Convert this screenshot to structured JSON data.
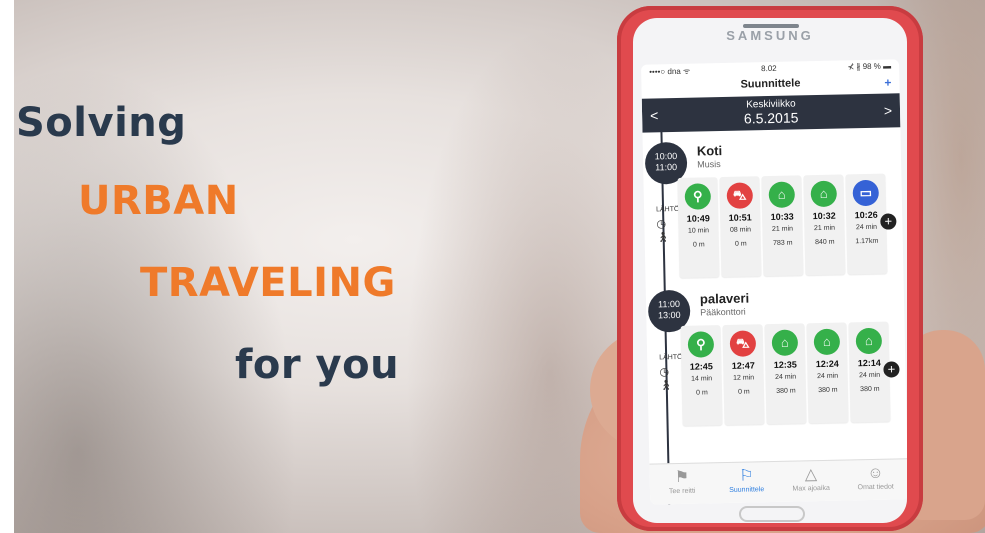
{
  "hero": {
    "line1": "Solving",
    "line2": "URBAN",
    "line3": "TRAVELING",
    "line4": "for you",
    "colors": {
      "dark": "#2a3a4d",
      "accent": "#ef7a2a"
    }
  },
  "carousel": {
    "active_index": 0,
    "count": 2
  },
  "phone": {
    "brand": "SAMSUNG",
    "status": {
      "carrier": "••••○ dna ᯤ",
      "time": "8.02",
      "battery": "⊀ ∦ 98 % ▬"
    },
    "nav_title": "Suunnittele",
    "nav_action": "+",
    "date": {
      "weekday": "Keskiviikko",
      "date": "6.5.2015",
      "prev": "<",
      "next": ">"
    },
    "labels": {
      "depart": "LÄHTÖ"
    },
    "events": [
      {
        "start": "10:00",
        "end": "11:00",
        "title": "Koti",
        "place": "Musis",
        "options": [
          {
            "mode": "bike-icon",
            "color": "green",
            "time": "10:49",
            "duration": "10 min",
            "distance": "0 m"
          },
          {
            "mode": "car-icon",
            "color": "red",
            "time": "10:51",
            "duration": "08 min",
            "distance": "0 m"
          },
          {
            "mode": "tram-icon",
            "color": "green",
            "time": "10:33",
            "duration": "21 min",
            "distance": "783 m"
          },
          {
            "mode": "tram-icon",
            "color": "green",
            "time": "10:32",
            "duration": "21 min",
            "distance": "840 m"
          },
          {
            "mode": "bus-icon",
            "color": "blue",
            "time": "10:26",
            "duration": "24 min",
            "distance": "1.17km"
          }
        ]
      },
      {
        "start": "11:00",
        "end": "13:00",
        "title": "palaveri",
        "place": "Pääkonttori",
        "options": [
          {
            "mode": "bike-icon",
            "color": "green",
            "time": "12:45",
            "duration": "14 min",
            "distance": "0 m"
          },
          {
            "mode": "car-icon",
            "color": "red",
            "time": "12:47",
            "duration": "12 min",
            "distance": "0 m"
          },
          {
            "mode": "tram-icon",
            "color": "green",
            "time": "12:35",
            "duration": "24 min",
            "distance": "380 m"
          },
          {
            "mode": "tram-icon",
            "color": "green",
            "time": "12:24",
            "duration": "24 min",
            "distance": "380 m"
          },
          {
            "mode": "tram-icon",
            "color": "green",
            "time": "12:14",
            "duration": "24 min",
            "distance": "380 m"
          }
        ]
      }
    ],
    "tabs": [
      {
        "label": "Tee reitti",
        "icon": "route-icon",
        "active": false
      },
      {
        "label": "Suunnittele",
        "icon": "plan-icon",
        "active": true
      },
      {
        "label": "Max ajoaika",
        "icon": "triangle-icon",
        "active": false
      },
      {
        "label": "Omat tiedot",
        "icon": "person-icon",
        "active": false
      }
    ]
  }
}
